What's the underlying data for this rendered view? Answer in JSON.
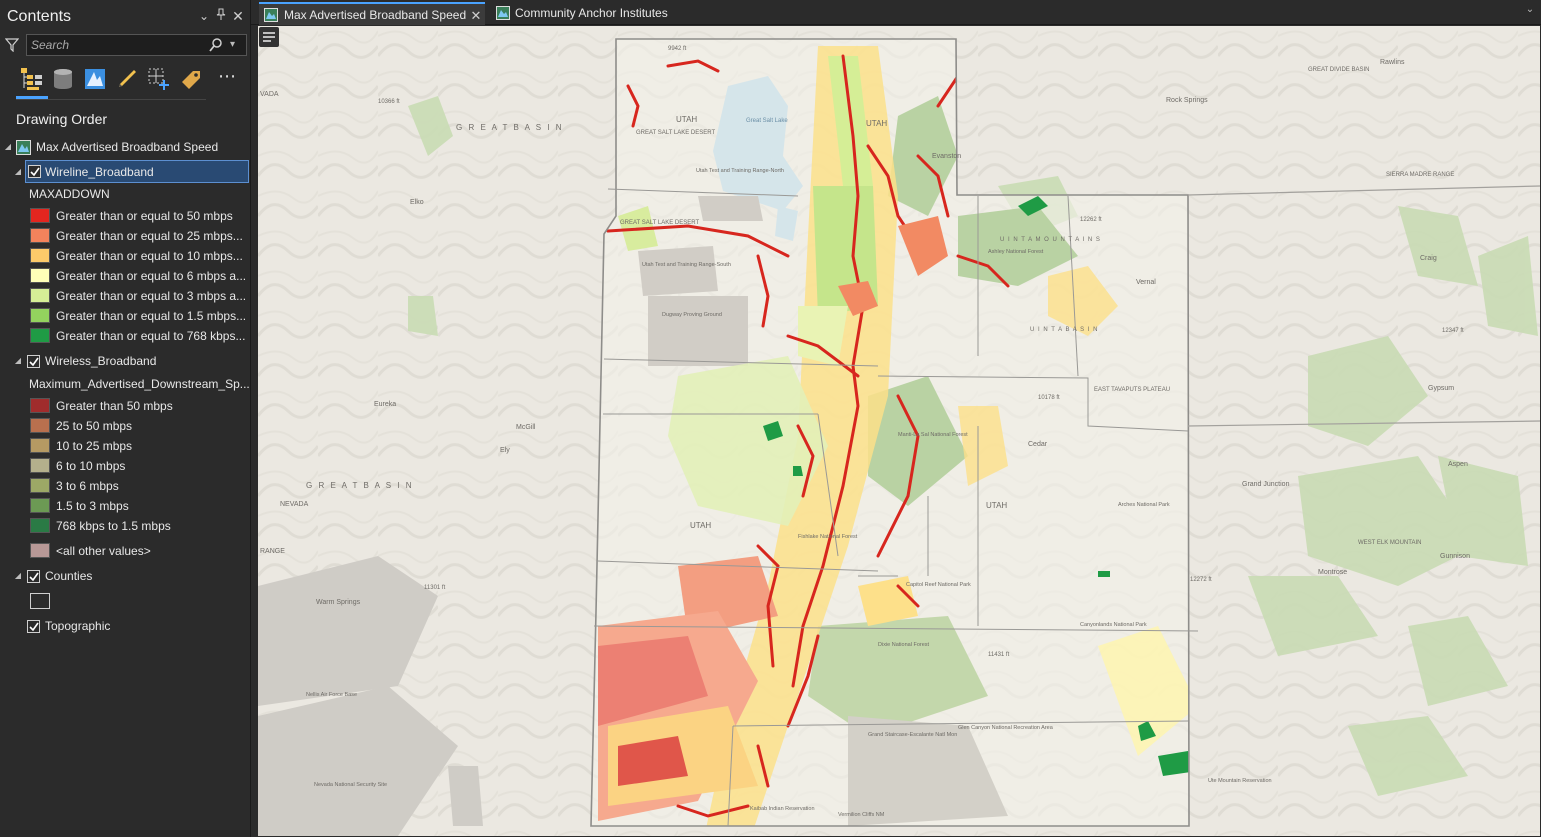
{
  "contents": {
    "title": "Contents",
    "search_placeholder": "Search",
    "drawing_order_label": "Drawing Order",
    "map_name": "Max Advertised Broadband Speed",
    "layers": {
      "wireline": {
        "name": "Wireline_Broadband",
        "field": "MAXADDOWN",
        "classes": [
          {
            "label": "Greater than or equal to 50 mbps",
            "color": "#e3261f"
          },
          {
            "label": "Greater than or equal to 25 mbps...",
            "color": "#f3835c"
          },
          {
            "label": "Greater than or equal to 10 mbps...",
            "color": "#fcca6a"
          },
          {
            "label": "Greater than or equal to 6 mbps a...",
            "color": "#ffffb8"
          },
          {
            "label": "Greater than or equal to 3 mbps a...",
            "color": "#d5ee96"
          },
          {
            "label": "Greater than or equal to 1.5 mbps...",
            "color": "#93d25e"
          },
          {
            "label": "Greater than or equal to 768 kbps...",
            "color": "#1f9b45"
          }
        ]
      },
      "wireless": {
        "name": "Wireless_Broadband",
        "field": "Maximum_Advertised_Downstream_Sp...",
        "classes": [
          {
            "label": "Greater than 50 mbps",
            "color": "#a02c2c"
          },
          {
            "label": "25 to 50 mbps",
            "color": "#b9704e"
          },
          {
            "label": "10 to 25 mbps",
            "color": "#b59a63"
          },
          {
            "label": "6 to 10 mbps",
            "color": "#b4b08c"
          },
          {
            "label": "3 to 6 mbps",
            "color": "#9ca866"
          },
          {
            "label": "1.5 to 3 mbps",
            "color": "#6c9a54"
          },
          {
            "label": "768 kbps to 1.5 mbps",
            "color": "#2a7a45"
          }
        ],
        "other": {
          "label": "<all other values>",
          "color": "#b79896"
        }
      },
      "counties": {
        "name": "Counties"
      },
      "topographic": {
        "name": "Topographic"
      }
    }
  },
  "tabs": [
    {
      "label": "Max Advertised Broadband Speed"
    },
    {
      "label": "Community Anchor Institutes"
    }
  ],
  "map": {
    "labels": {
      "great_basin_1": "G R E A T   B A S I N",
      "great_basin_2": "G R E A T   B A S I N",
      "great_salt_lake": "Great Salt Lake",
      "gsl_desert": "GREAT SALT LAKE DESERT",
      "gsl_desert_2": "GREAT SALT LAKE DESERT",
      "utah_1": "UTAH",
      "utah_2": "UTAH",
      "utah_3": "UTAH",
      "utah_4": "UTAH",
      "uinta_mtns": "U I N T A   M O U N T A I N S",
      "uinta_basin": "U I N T A   B A S I N",
      "tavaputs": "EAST TAVAPUTS PLATEAU",
      "great_divide": "GREAT DIVIDE BASIN",
      "sierra_madre": "SIERRA MADRE RANGE",
      "west_elk": "WEST ELK MOUNTAIN",
      "nevada": "NEVADA",
      "vada": "VADA",
      "range": "RANGE",
      "evanston": "Evanston",
      "rock_springs": "Rock Springs",
      "rawlins": "Rawlins",
      "craig": "Craig",
      "gypsum": "Gypsum",
      "aspen": "Aspen",
      "grand_junction": "Grand Junction",
      "montrose": "Montrose",
      "gunnison": "Gunnison",
      "cedar": "Cedar",
      "elko": "Elko",
      "ely": "Ely",
      "eureka": "Eureka",
      "mcgill": "McGill",
      "warm_springs": "Warm Springs",
      "vernal": "Vernal",
      "dugway": "Dugway Proving Ground",
      "utah_test_north": "Utah Test and Training Range-North",
      "utah_test_south": "Utah Test and Training Range-South",
      "nellis": "Nellis Air Force Base",
      "nevada_security": "Nevada National Security Site",
      "grand_staircase": "Grand Staircase-Escalante Natl Mon",
      "glen_canyon": "Glen Canyon National Recreation Area",
      "capitol_reef": "Capitol Reef National Park",
      "canyonlands": "Canyonlands National Park",
      "arches": "Arches National Park",
      "kaibab": "Kaibab Indian Reservation",
      "vermilion": "Vermilion Cliffs NM",
      "ute_mountain": "Ute Mountain Reservation",
      "dixie": "Dixie National Forest",
      "fishlake": "Fishlake National Forest",
      "manti": "Manti-La Sal National Forest",
      "ashley": "Ashley National Forest",
      "elev_1": "9942 ft",
      "elev_2": "10178 ft",
      "elev_3": "12262 ft",
      "elev_4": "11431 ft",
      "elev_5": "12272 ft",
      "elev_6": "11301 ft",
      "elev_7": "10366 ft",
      "elev_8": "12347 ft"
    }
  }
}
